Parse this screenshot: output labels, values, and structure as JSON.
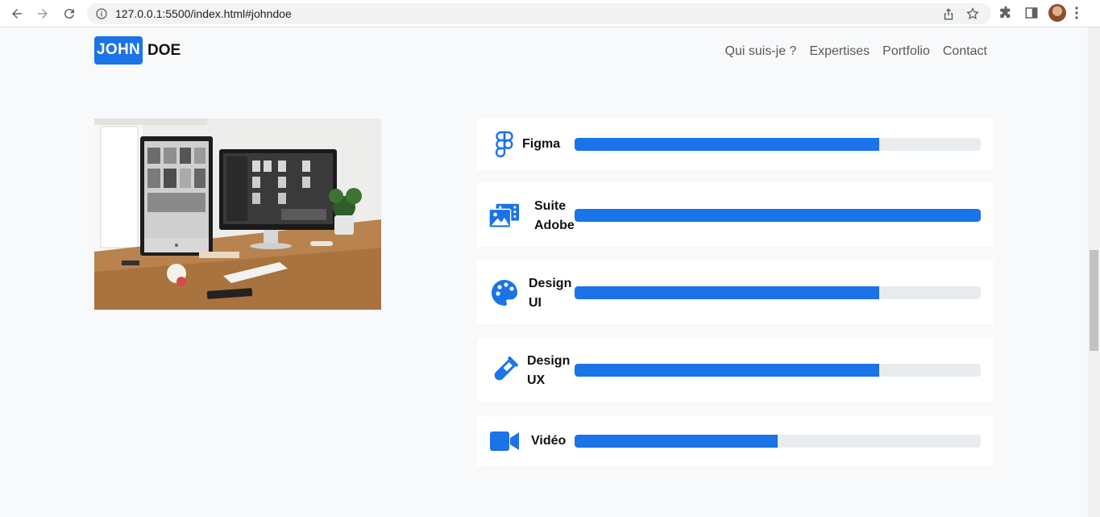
{
  "browser": {
    "url": "127.0.0.1:5500/index.html#johndoe",
    "icons": [
      "back-arrow-icon",
      "forward-arrow-icon",
      "reload-icon",
      "info-icon",
      "share-icon",
      "star-icon",
      "extensions-icon",
      "side-panel-icon",
      "profile-avatar",
      "menu-kebab-icon"
    ]
  },
  "site": {
    "logo_first": "JOHN",
    "logo_last": "DOE",
    "nav": [
      "Qui suis-je ?",
      "Expertises",
      "Portfolio",
      "Contact"
    ],
    "accent": "#1a73e8"
  },
  "skills": [
    {
      "label_lines": [
        "Figma"
      ],
      "icon": "figma-icon",
      "level": 0.75
    },
    {
      "label_lines": [
        "Suite",
        "Adobe"
      ],
      "icon": "photo-film-icon",
      "level": 1.0
    },
    {
      "label_lines": [
        "Design",
        "UI"
      ],
      "icon": "palette-icon",
      "level": 0.75
    },
    {
      "label_lines": [
        "Design",
        "UX"
      ],
      "icon": "test-tube-icon",
      "level": 0.75
    },
    {
      "label_lines": [
        "Vidéo"
      ],
      "icon": "video-camera-icon",
      "level": 0.5
    }
  ]
}
